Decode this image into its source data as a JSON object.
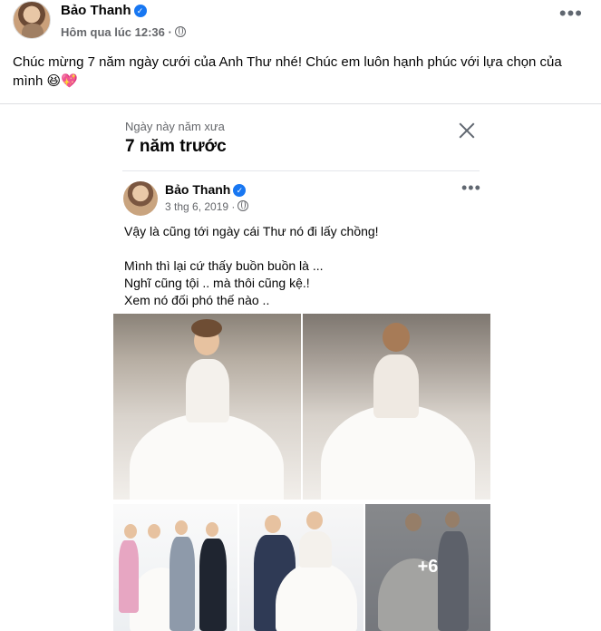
{
  "post": {
    "author": "Bảo Thanh",
    "timestamp": "Hôm qua lúc 12:36 ·",
    "text": "Chúc mừng 7 năm ngày cưới của Anh Thư nhé! Chúc em luôn hạnh phúc với lựa chọn của mình 😆💖"
  },
  "memory": {
    "subtitle": "Ngày này năm xưa",
    "title": "7 năm trước",
    "original_post": {
      "author": "Bảo Thanh",
      "date": "3 thg 6, 2019 ·",
      "text": "Vậy là cũng tới ngày cái Thư nó đi lấy chồng!\n\nMình thì lại cứ thấy buồn buồn là ...\nNghĩ cũng tội .. mà thôi cũng kệ.!\nXem nó đối phó thế nào ..",
      "more_photos": "+6"
    }
  },
  "icons": {
    "verified": "verified-badge-icon",
    "privacy": "globe-icon",
    "more": "more-options-icon",
    "close": "close-icon"
  },
  "colors": {
    "verified_blue": "#1877f2",
    "meta_gray": "#65676b"
  }
}
